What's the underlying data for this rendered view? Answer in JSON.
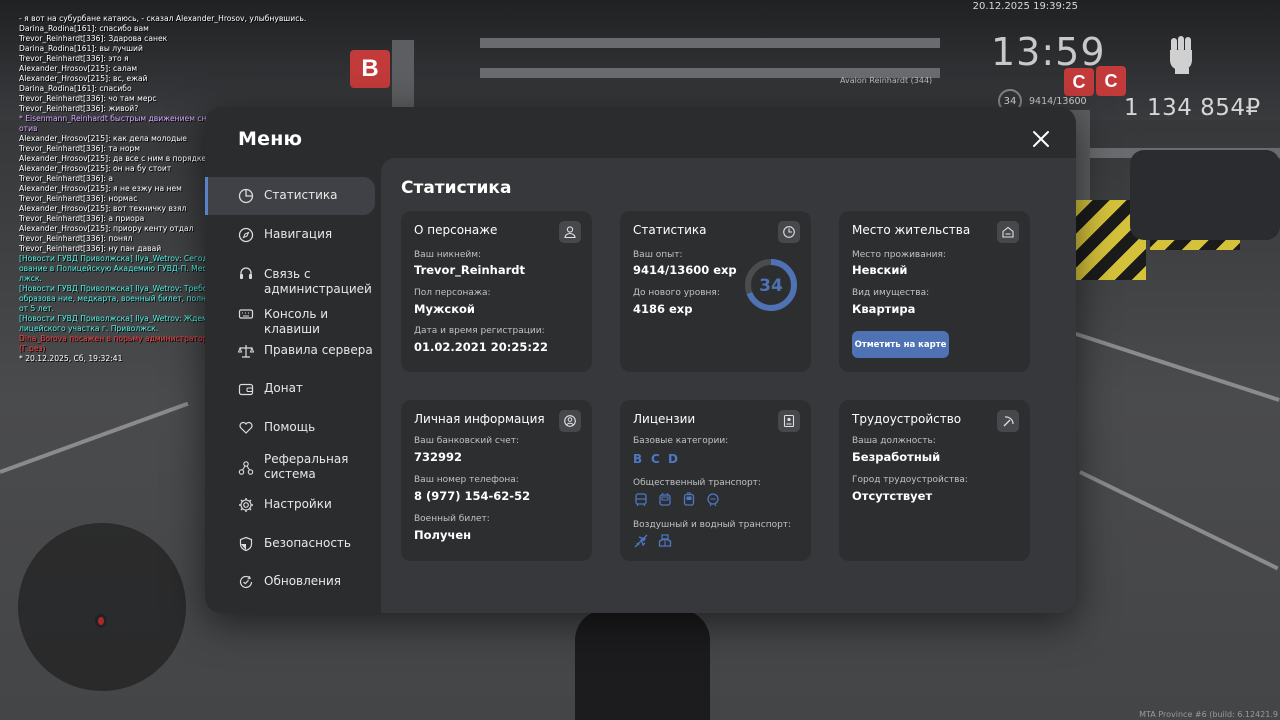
{
  "hud": {
    "datetime": "20.12.2025 19:39:25",
    "time": "13:59",
    "player_name": "Avalon Reinhardt (344)",
    "level": "34",
    "exp": "9414/13600",
    "money": "1 134 854₽",
    "build": "MTA Province #6 (build: 6.12421.9"
  },
  "chat": [
    {
      "text": "- я вот на субурбане катаюсь, - сказал Alexander_Hrosov, улыбнувшись.",
      "color": "white"
    },
    {
      "text": "Darina_Rodina[161]: спасибо вам",
      "color": "white"
    },
    {
      "text": "Trevor_Reinhardt[336]: Здарова санек",
      "color": "white"
    },
    {
      "text": "Darina_Rodina[161]: вы лучший",
      "color": "white"
    },
    {
      "text": "Trevor_Reinhardt[336]: это я",
      "color": "white"
    },
    {
      "text": "Alexander_Hrosov[215]: салам",
      "color": "white"
    },
    {
      "text": "Alexander_Hrosov[215]: вс, ежай",
      "color": "white"
    },
    {
      "text": "Darina_Rodina[161]: спасибо",
      "color": "white"
    },
    {
      "text": "Trevor_Reinhardt[336]: чо там мерс",
      "color": "white"
    },
    {
      "text": "Trevor_Reinhardt[336]: живой?",
      "color": "white"
    },
    {
      "text": "* Eisenmann_Reinhardt быстрым движением снял очки с лица человека напр отив",
      "color": "purple"
    },
    {
      "text": "Alexander_Hrosov[215]: как дела молодые",
      "color": "white"
    },
    {
      "text": "Trevor_Reinhardt[336]: та норм",
      "color": "white"
    },
    {
      "text": "Alexander_Hrosov[215]: да все с ним в порядке",
      "color": "white"
    },
    {
      "text": "Alexander_Hrosov[215]: он на бу стоит",
      "color": "white"
    },
    {
      "text": "Trevor_Reinhardt[336]: а",
      "color": "white"
    },
    {
      "text": "Alexander_Hrosov[215]: я не езжу на нем",
      "color": "white"
    },
    {
      "text": "Trevor_Reinhardt[336]: нормас",
      "color": "white"
    },
    {
      "text": "Alexander_Hrosov[215]: вот техничку взял",
      "color": "white"
    },
    {
      "text": "Trevor_Reinhardt[336]: а приора",
      "color": "white"
    },
    {
      "text": "Alexander_Hrosov[215]: приору кенту отдал",
      "color": "white"
    },
    {
      "text": "Trevor_Reinhardt[336]: понял",
      "color": "white"
    },
    {
      "text": "Trevor_Reinhardt[336]: ну пан давай",
      "color": "white"
    },
    {
      "text": "[Новости ГУВД Приволжска] Ilya_Wetrov: Сегодня в 20:00 состоится собесед ование в Полицейскую Академию ГУВД-П. Место: парковка участка г. Прово лжск.",
      "color": "cyan"
    },
    {
      "text": "[Новости ГУВД Приволжска] Ilya_Wetrov: Требования: опрятность, юр. образова ние, медкарта, военный билет, полный пакет документов, прописка от 5 лет.",
      "color": "cyan"
    },
    {
      "text": "[Новости ГУВД Приволжска] Ilya_Wetrov: Ждем всех желающих на парковке по лицейского участка г. Приволжск.",
      "color": "cyan"
    },
    {
      "text": "Dina_Borova посажен в порьму администратором Savva_Sharkov (30 мин) (Г.рез)",
      "color": "red"
    },
    {
      "text": "* 20.12.2025, Сб, 19:32:41",
      "color": "white"
    }
  ],
  "menu": {
    "title": "Меню",
    "nav": [
      {
        "label": "Статистика",
        "icon": "pie-chart-icon"
      },
      {
        "label": "Навигация",
        "icon": "compass-icon"
      },
      {
        "label": "Связь с администрацией",
        "icon": "support-icon"
      },
      {
        "label": "Консоль и клавиши",
        "icon": "keyboard-icon"
      },
      {
        "label": "Правила сервера",
        "icon": "scales-icon"
      },
      {
        "label": "Донат",
        "icon": "wallet-icon"
      },
      {
        "label": "Помощь",
        "icon": "heart-hands-icon"
      },
      {
        "label": "Реферальная система",
        "icon": "network-icon"
      },
      {
        "label": "Настройки",
        "icon": "gear-icon"
      },
      {
        "label": "Безопасность",
        "icon": "shield-icon"
      },
      {
        "label": "Обновления",
        "icon": "refresh-icon"
      }
    ],
    "active": "Статистика"
  },
  "stats": {
    "title": "Статистика",
    "character": {
      "title": "О персонаже",
      "nickname_label": "Ваш никнейм:",
      "nickname": "Trevor_Reinhardt",
      "gender_label": "Пол персонажа:",
      "gender": "Мужской",
      "reg_label": "Дата и время регистрации:",
      "reg": "01.02.2021 20:25:22"
    },
    "statistics": {
      "title": "Статистика",
      "exp_label": "Ваш опыт:",
      "exp": "9414/13600 exp",
      "next_label": "До нового уровня:",
      "next": "4186 exp",
      "level": "34",
      "progress": 0.692
    },
    "residence": {
      "title": "Место жительства",
      "place_label": "Место проживания:",
      "place": "Невский",
      "property_label": "Вид имущества:",
      "property": "Квартира",
      "map_button": "Отметить на карте"
    },
    "personal": {
      "title": "Личная информация",
      "bank_label": "Ваш банковский счет:",
      "bank": "732992",
      "phone_label": "Ваш номер телефона:",
      "phone": "8 (977) 154-62-52",
      "military_label": "Военный билет:",
      "military": "Получен"
    },
    "licenses": {
      "title": "Лицензии",
      "base_label": "Базовые категории:",
      "categories": [
        "B",
        "C",
        "D"
      ],
      "public_label": "Общественный транспорт:",
      "air_label": "Воздушный и водный транспорт:"
    },
    "employment": {
      "title": "Трудоустройство",
      "position_label": "Ваша должность:",
      "position": "Безработный",
      "city_label": "Город трудоустройства:",
      "city": "Отсутствует"
    }
  },
  "colors": {
    "accent": "#4e72b3",
    "license": "#4d78c4"
  }
}
